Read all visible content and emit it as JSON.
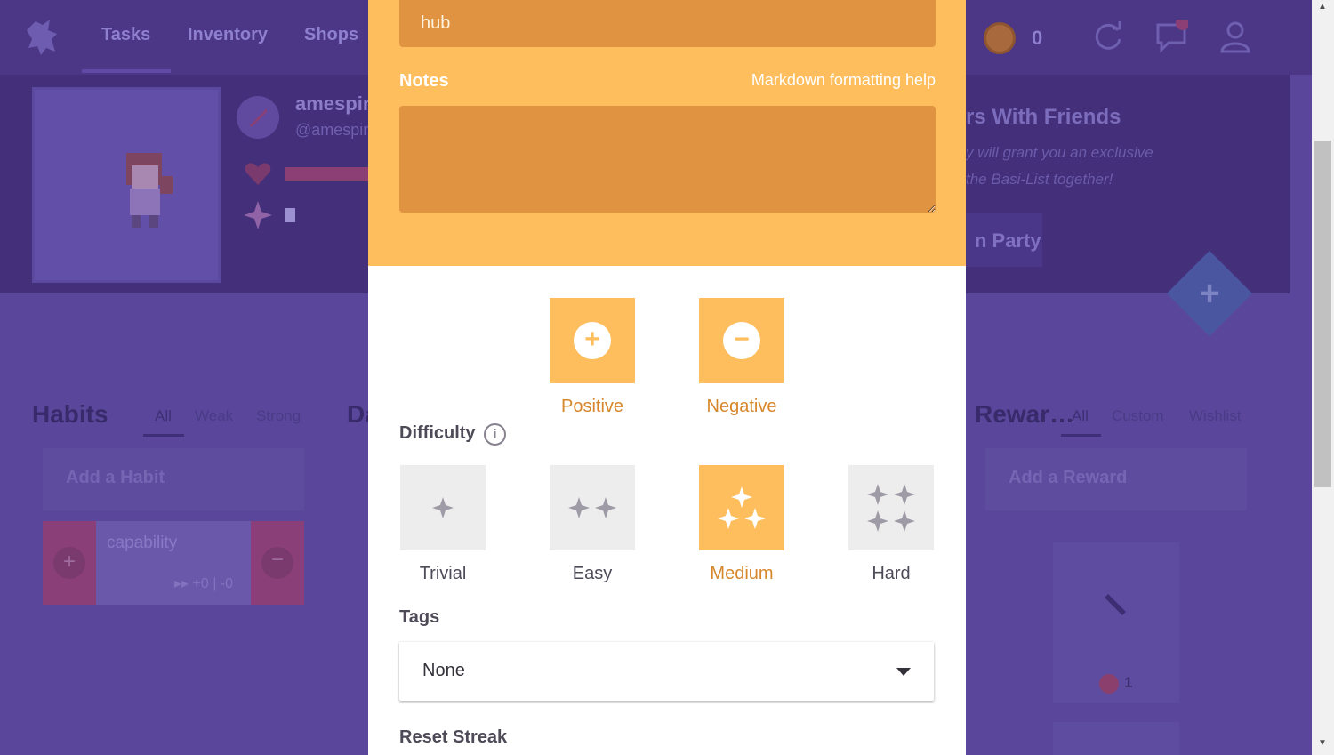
{
  "app": {
    "nav": [
      "Tasks",
      "Inventory",
      "Shops"
    ],
    "gold": "0",
    "user": {
      "name": "amespin",
      "handle": "@amespin"
    },
    "party_banner": {
      "title": "rs With Friends",
      "line1": "y will grant you an exclusive",
      "line2": "the Basi-List together!",
      "button": "n Party"
    },
    "columns": {
      "habits": {
        "title": "Habits",
        "tabs": [
          "All",
          "Weak",
          "Strong"
        ],
        "add_placeholder": "Add a Habit",
        "item": {
          "text": "capability",
          "count": "▸▸ +0 | -0"
        }
      },
      "dailies": {
        "title": "Da"
      },
      "rewards": {
        "title": "Rewar…",
        "tabs": [
          "All",
          "Custom",
          "Wishlist"
        ],
        "add_placeholder": "Add a Reward",
        "item_price": "1"
      }
    }
  },
  "modal": {
    "title_value": "hub",
    "notes_label": "Notes",
    "markdown_help": "Markdown formatting help",
    "notes_value": "",
    "habit_buttons": {
      "positive": {
        "label": "Positive",
        "symbol": "+"
      },
      "negative": {
        "label": "Negative",
        "symbol": "−"
      }
    },
    "difficulty": {
      "label": "Difficulty",
      "info_symbol": "i",
      "options": [
        "Trivial",
        "Easy",
        "Medium",
        "Hard"
      ],
      "selected": "Medium"
    },
    "tags": {
      "label": "Tags",
      "value": "None"
    },
    "reset_streak_label": "Reset Streak"
  },
  "colors": {
    "accent": "#ffbe5d",
    "accent_dark": "#e09341",
    "accent_text": "#d7872b",
    "backdrop": "#5a479b"
  }
}
